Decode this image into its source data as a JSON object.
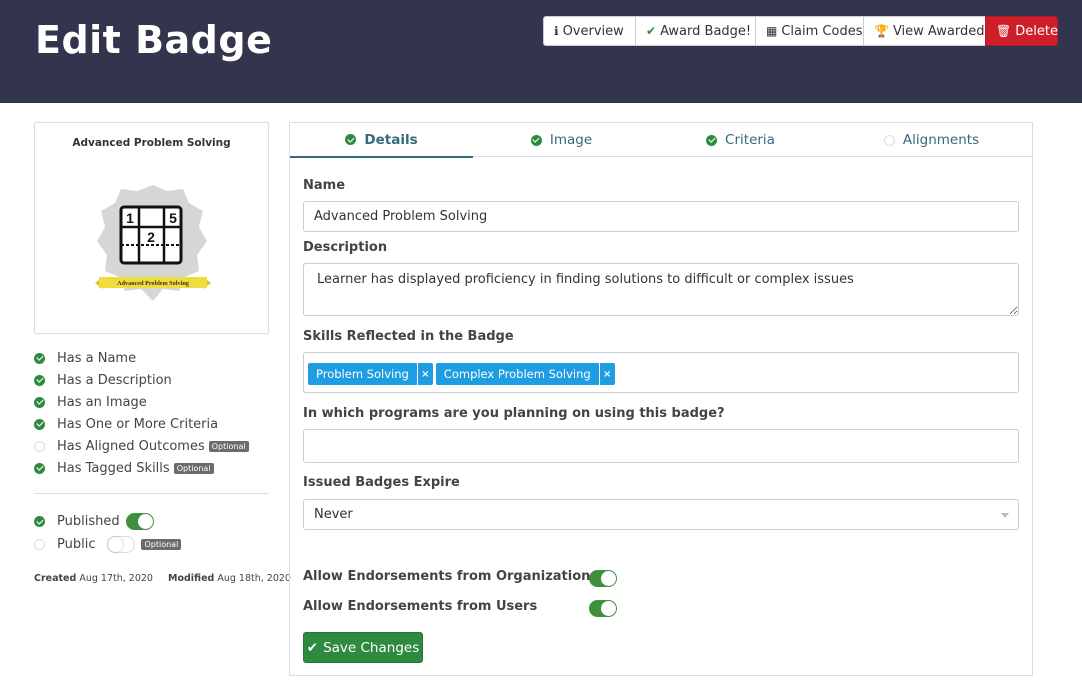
{
  "header": {
    "title": "Edit Badge",
    "actions": [
      {
        "icon": "info-circle-icon",
        "glyph": "ℹ",
        "label": "Overview"
      },
      {
        "icon": "check-icon",
        "glyph": "✔",
        "label": "Award Badge!"
      },
      {
        "icon": "qr-code-icon",
        "glyph": "▦",
        "label": "Claim Codes"
      },
      {
        "icon": "trophy-icon",
        "glyph": "🏆",
        "label": "View Awarded"
      },
      {
        "icon": "trash-icon",
        "glyph": "🗑",
        "label": "Delete"
      }
    ]
  },
  "badge_card": {
    "title": "Advanced Problem Solving",
    "image_text": {
      "numbers": [
        "1",
        "5",
        "2"
      ],
      "ribbon": "Advanced Problem Solving"
    }
  },
  "checklist": [
    {
      "label": "Has a Name",
      "done": true,
      "optional": false
    },
    {
      "label": "Has a Description",
      "done": true,
      "optional": false
    },
    {
      "label": "Has an Image",
      "done": true,
      "optional": false
    },
    {
      "label": "Has One or More Criteria",
      "done": true,
      "optional": false
    },
    {
      "label": "Has Aligned Outcomes",
      "done": false,
      "optional": true
    },
    {
      "label": "Has Tagged Skills",
      "done": true,
      "optional": true
    }
  ],
  "optional_label": "Optional",
  "publish": {
    "published_label": "Published",
    "published_on": true,
    "public_label": "Public",
    "public_on": false
  },
  "meta": {
    "created_label": "Created",
    "created_date": "Aug 17th, 2020",
    "modified_label": "Modified",
    "modified_date": "Aug 18th, 2020"
  },
  "tabs": [
    {
      "label": "Details",
      "done": true,
      "active": true
    },
    {
      "label": "Image",
      "done": true,
      "active": false
    },
    {
      "label": "Criteria",
      "done": true,
      "active": false
    },
    {
      "label": "Alignments",
      "done": false,
      "active": false
    }
  ],
  "form": {
    "name_label": "Name",
    "name_value": "Advanced Problem Solving",
    "description_label": "Description",
    "description_value": "Learner has displayed proficiency in finding solutions to difficult or complex issues",
    "skills_label": "Skills Reflected in the Badge",
    "skills": [
      "Problem Solving",
      "Complex Problem Solving"
    ],
    "programs_label": "In which programs are you planning on using this badge?",
    "programs_value": "",
    "expire_label": "Issued Badges Expire",
    "expire_value": "Never",
    "endorse_orgs_label": "Allow Endorsements from Organizations",
    "endorse_orgs_on": true,
    "endorse_users_label": "Allow Endorsements from Users",
    "endorse_users_on": true,
    "save_label": "Save Changes"
  },
  "colors": {
    "header_bg": "#33344d",
    "success": "#2e8b3d",
    "danger": "#cc1f29",
    "tag": "#1f9de2",
    "tab_text": "#336a7a"
  }
}
